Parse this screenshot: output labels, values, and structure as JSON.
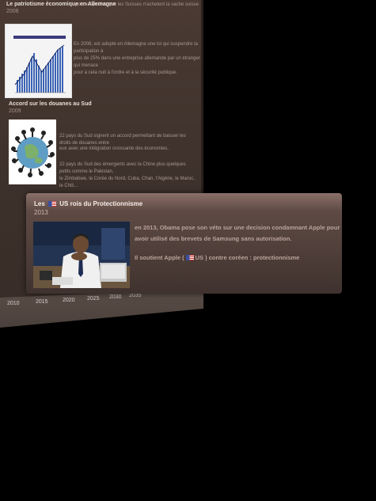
{
  "wall": {
    "top_faint": "pour empecher que les Suisses n'achetent la vache suisse",
    "section1": {
      "title": "Le patriotisme économique en Allemagne",
      "year": "2008",
      "text_lines": [
        "En 2008, est adopté en Allemagne une loi qui suspendre la participation à",
        "plus de 25% dans une entreprise allemande par un étranger qui menace",
        "pour à cela nuit à l'ordre et à la sécurité publique."
      ]
    },
    "section2": {
      "title": "Accord sur les douanes au Sud",
      "year": "2009",
      "text_lines_a": [
        "22 pays du Sud signent un accord permettant de baisser les droits de douanes entre",
        "eux avec une intégration croissante des économies."
      ],
      "text_lines_b": [
        "22 pays du Sud des émergents avec la Chine plus quelques petits comme le Pakistan,",
        "le Zimbabwe, la Corée du Nord, Cuba, Chan, l'Algérie, le Maroc, le Chili..."
      ]
    },
    "timeline_ticks": [
      "2010",
      "2015",
      "2020",
      "2025",
      "2030",
      "2035"
    ]
  },
  "card": {
    "title_pre": "Les",
    "title_post": "US rois du Protectionnisme",
    "year": "2013",
    "paragraph1_line1": "en 2013, Obama pose son véto sur une decision condamnant Apple pour",
    "paragraph1_line2": "avoir utilisé des brevets de Samsung sans autorisation.",
    "paragraph2_pre": "Il soutient Apple (",
    "paragraph2_post": "US ) contre coréen : protectionnisme"
  },
  "colors": {
    "background": "#000000",
    "wall": "#3d312b",
    "card_top": "#8a7068",
    "card_bottom": "#3f322e",
    "card_text": "#b9a49a"
  }
}
